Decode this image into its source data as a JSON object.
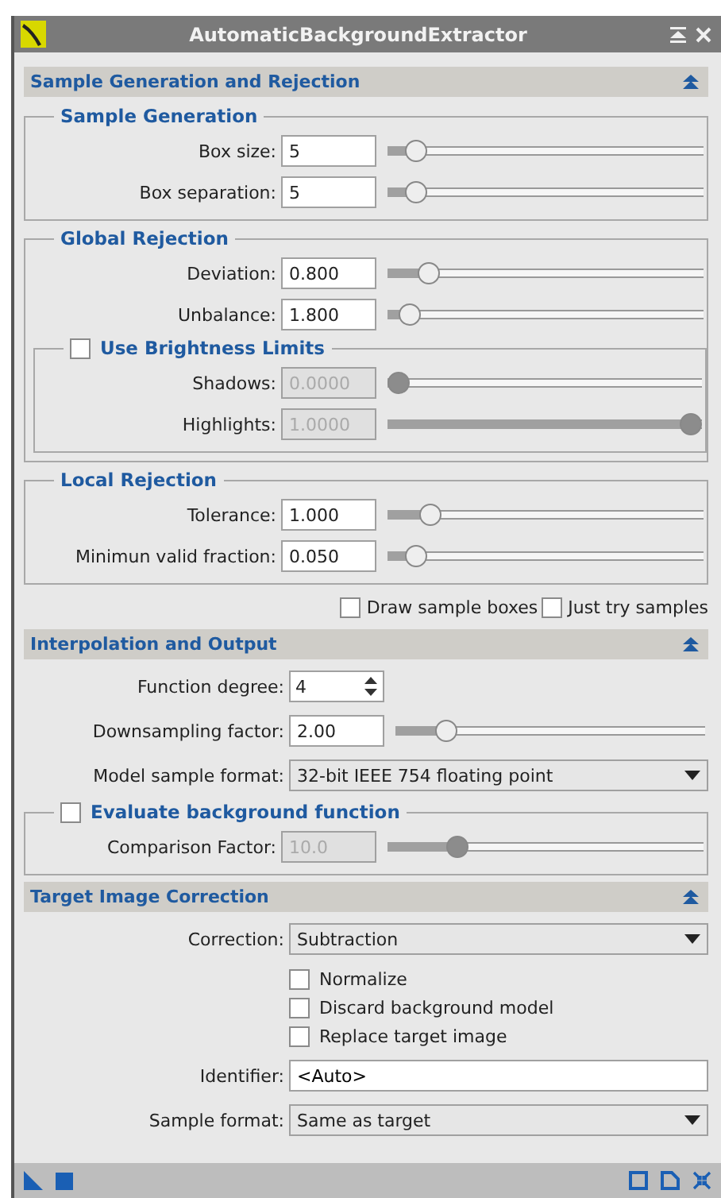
{
  "window": {
    "title": "AutomaticBackgroundExtractor"
  },
  "sections": [
    {
      "title": "Sample Generation and Rejection",
      "expanded": true,
      "items": [
        {
          "kind": "group",
          "title": "Sample Generation",
          "items": [
            {
              "kind": "slider",
              "label": "Box size:",
              "value": "5",
              "level": 0.06,
              "disabled": false
            },
            {
              "kind": "slider",
              "label": "Box separation:",
              "value": "5",
              "level": 0.06,
              "disabled": false
            }
          ]
        },
        {
          "kind": "group",
          "title": "Global Rejection",
          "items": [
            {
              "kind": "slider",
              "label": "Deviation:",
              "value": "0.800",
              "level": 0.1,
              "disabled": false
            },
            {
              "kind": "slider",
              "label": "Unbalance:",
              "value": "1.800",
              "level": 0.04,
              "disabled": false
            },
            {
              "kind": "group",
              "title": "Use Brightness Limits",
              "checked": false,
              "items": [
                {
                  "kind": "slider",
                  "label": "Shadows:",
                  "value": "0.0000",
                  "level": 0,
                  "disabled": true
                },
                {
                  "kind": "slider",
                  "label": "Highlights:",
                  "value": "1.0000",
                  "level": 1,
                  "disabled": true
                }
              ]
            }
          ]
        },
        {
          "kind": "group",
          "title": "Local Rejection",
          "items": [
            {
              "kind": "slider",
              "label": "Tolerance:",
              "value": "1.000",
              "level": 0.11,
              "disabled": false
            },
            {
              "kind": "slider",
              "label": "Minimun valid fraction:",
              "value": "0.050",
              "level": 0.06,
              "disabled": false
            }
          ]
        },
        {
          "kind": "checkline",
          "items": [
            {
              "label": "Draw sample boxes",
              "checked": false
            },
            {
              "label": "Just try samples",
              "checked": false
            }
          ]
        }
      ]
    },
    {
      "title": "Interpolation and Output",
      "expanded": true,
      "items": [
        {
          "kind": "spin",
          "label": "Function degree:",
          "value": "4"
        },
        {
          "kind": "slider",
          "label": "Downsampling factor:",
          "value": "2.00",
          "level": 0.14,
          "disabled": false
        },
        {
          "kind": "combo",
          "label": "Model sample format:",
          "value": "32-bit IEEE 754 floating point"
        },
        {
          "kind": "group",
          "title": "Evaluate background function",
          "checked": false,
          "items": [
            {
              "kind": "slider",
              "label": "Comparison Factor:",
              "value": "10.0",
              "level": 0.2,
              "disabled": true
            }
          ]
        }
      ]
    },
    {
      "title": "Target Image Correction",
      "expanded": true,
      "items": [
        {
          "kind": "combo",
          "label": "Correction:",
          "value": "Subtraction"
        },
        {
          "kind": "checks",
          "items": [
            {
              "label": "Normalize",
              "checked": false
            },
            {
              "label": "Discard background model",
              "checked": false
            },
            {
              "label": "Replace target image",
              "checked": false
            }
          ]
        },
        {
          "kind": "text",
          "label": "Identifier:",
          "value": "<Auto>"
        },
        {
          "kind": "combo",
          "label": "Sample format:",
          "value": "Same as target"
        }
      ]
    }
  ]
}
